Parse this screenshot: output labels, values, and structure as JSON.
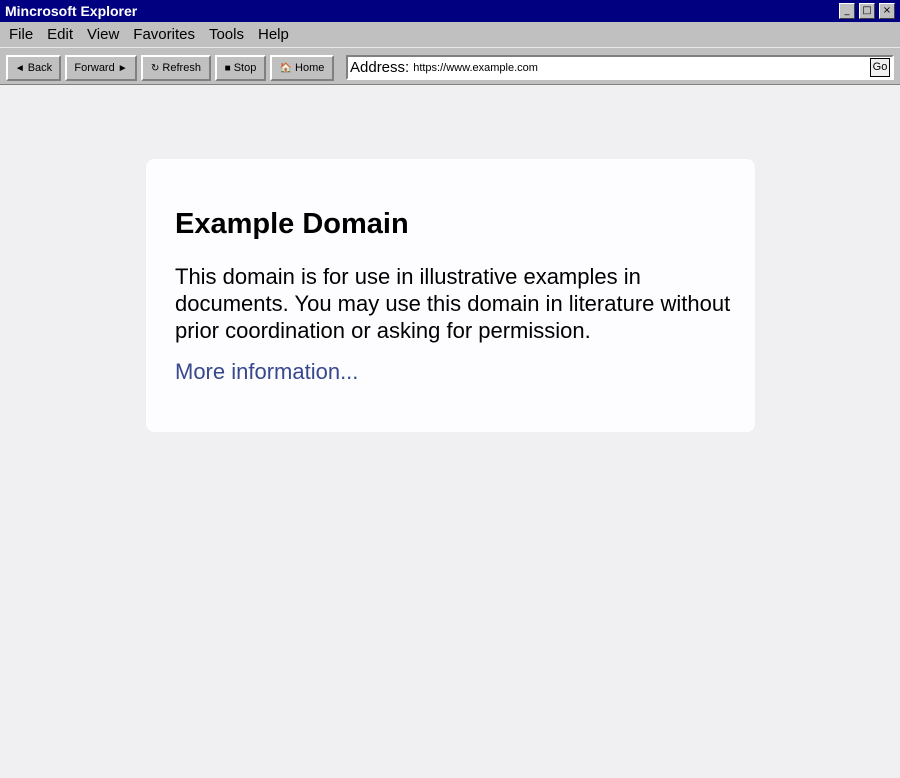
{
  "window": {
    "title": "Mincrosoft Explorer",
    "controls": {
      "minimize": "_",
      "maximize": "□",
      "close": "×"
    }
  },
  "menu": [
    "File",
    "Edit",
    "View",
    "Favorites",
    "Tools",
    "Help"
  ],
  "toolbar": {
    "back": {
      "icon": "◄",
      "label": "Back"
    },
    "forward": {
      "icon": "►",
      "label": "Forward"
    },
    "refresh": {
      "icon": "↻",
      "label": "Refresh"
    },
    "stop": {
      "icon": "■",
      "label": "Stop"
    },
    "home": {
      "icon": "🏠",
      "label": "Home"
    },
    "address_label": "Address:",
    "url": "https://www.example.com",
    "go_label": "Go"
  },
  "page": {
    "heading": "Example Domain",
    "body": "This domain is for use in illustrative examples in documents. You may use this domain in literature without prior coordination or asking for permission.",
    "link": "More information..."
  },
  "colors": {
    "titlebar": "#000080",
    "chrome": "#c0c0c0",
    "page_background": "#f0f0f2",
    "card_background": "#fdfdff",
    "link": "#38488f"
  }
}
